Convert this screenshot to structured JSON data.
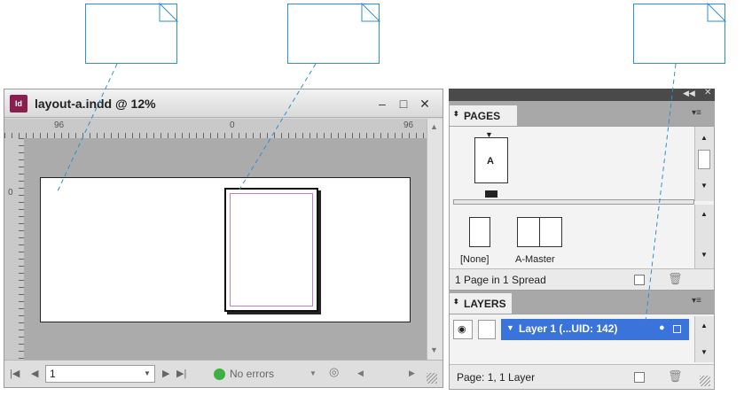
{
  "document_window": {
    "title": "layout-a.indd @ 12%",
    "ruler_marks": {
      "left": "96",
      "center": "0",
      "right": "96",
      "vertical_zero": "0"
    },
    "status": {
      "page_field": "1",
      "preflight_text": "No errors",
      "preflight_color": "#3cb043"
    }
  },
  "pages_panel": {
    "tab_label": "PAGES",
    "page_prefix": "A",
    "masters": [
      {
        "label": "[None]"
      },
      {
        "label": "A-Master"
      }
    ],
    "footer_text": "1 Page in 1 Spread"
  },
  "layers_panel": {
    "tab_label": "LAYERS",
    "layer_name": "Layer 1 (...UID: 142)",
    "footer_text": "Page: 1, 1 Layer"
  },
  "colors": {
    "callout_line": "#2f8fd0",
    "selection": "#3a73d9",
    "margin_guide": "#c37ad0",
    "indesign_icon": "#8a1f4e"
  }
}
